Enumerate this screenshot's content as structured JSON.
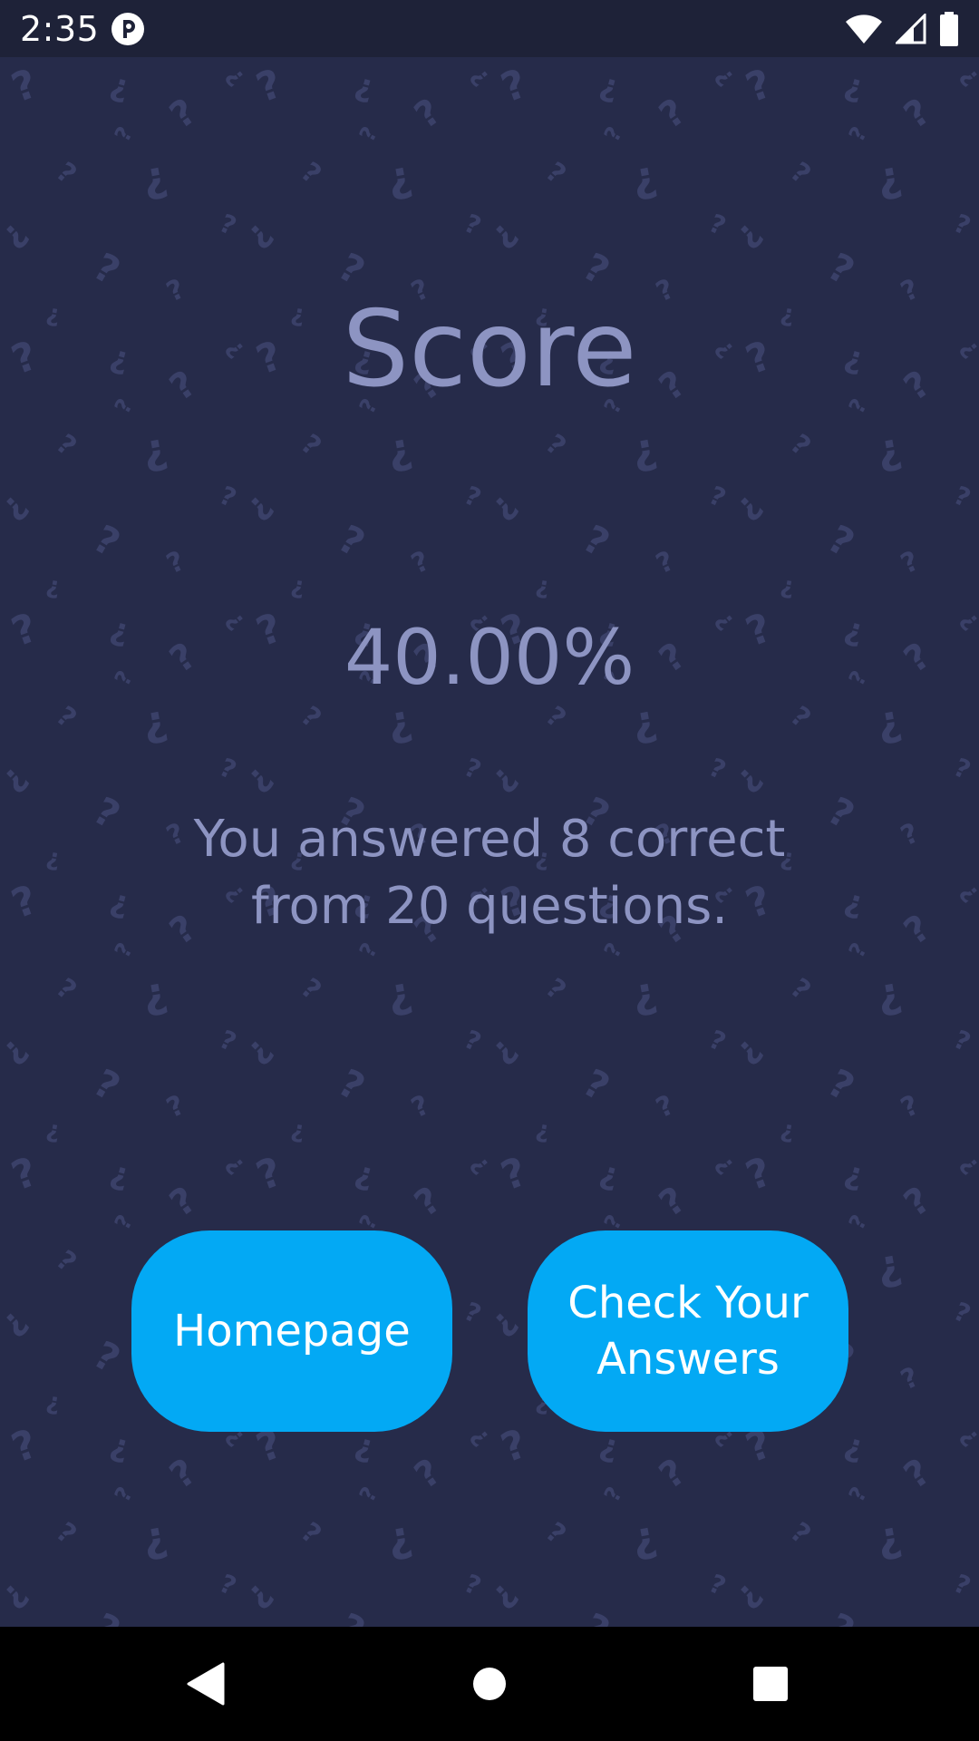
{
  "status_bar": {
    "time": "2:35",
    "app_icon": "privacy-app-icon",
    "icons": [
      "wifi-icon",
      "cell-signal-icon",
      "battery-icon"
    ]
  },
  "score": {
    "title": "Score",
    "percent": "40.00%",
    "summary": "You answered 8 correct from 20 questions."
  },
  "buttons": {
    "homepage": "Homepage",
    "check_answers": "Check Your Answers"
  },
  "nav_bar": {
    "icons": [
      "back-icon",
      "home-icon",
      "recents-icon"
    ]
  },
  "colors": {
    "background": "#262b4a",
    "status_bar": "#1e2238",
    "text": "#8d94c2",
    "button": "#03a9f4",
    "button_text": "#ffffff"
  }
}
